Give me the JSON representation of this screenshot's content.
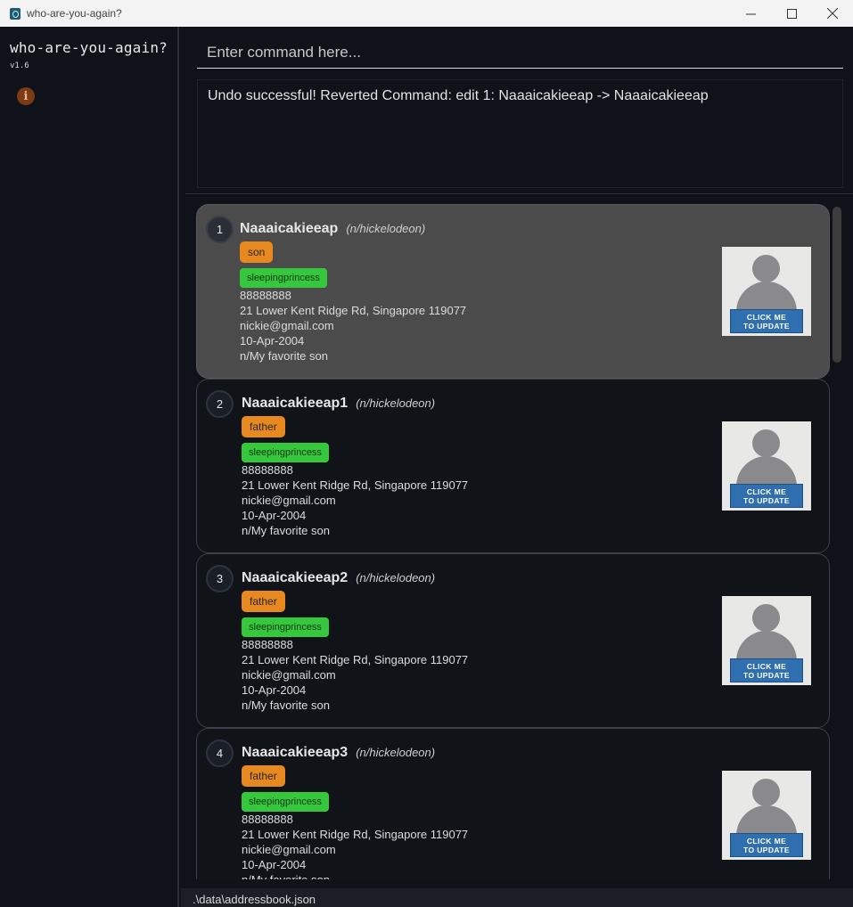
{
  "window": {
    "title": "who-are-you-again?",
    "controls": {
      "minimize": "—",
      "maximize": "☐",
      "close": "✕"
    }
  },
  "sidebar": {
    "app_name": "who-are-you-again?",
    "version": "v1.6",
    "info_icon": "info-icon"
  },
  "command": {
    "placeholder": "Enter command here..."
  },
  "result": {
    "text": "Undo successful! Reverted Command: edit 1: Naaaicakieeap -> Naaaicakieeap"
  },
  "persons": [
    {
      "index": "1",
      "name": "Naaaicakieeap",
      "nickname": "(n/hickelodeon)",
      "relationship": "son",
      "tag": "sleepingprincess",
      "phone": "88888888",
      "address": "21 Lower Kent Ridge Rd, Singapore 119077",
      "email": "nickie@gmail.com",
      "birthday": "10-Apr-2004",
      "remark": "n/My favorite son",
      "photo_label_1": "CLICK ME",
      "photo_label_2": "TO UPDATE"
    },
    {
      "index": "2",
      "name": "Naaaicakieeap1",
      "nickname": "(n/hickelodeon)",
      "relationship": "father",
      "tag": "sleepingprincess",
      "phone": "88888888",
      "address": "21 Lower Kent Ridge Rd, Singapore 119077",
      "email": "nickie@gmail.com",
      "birthday": "10-Apr-2004",
      "remark": "n/My favorite son",
      "photo_label_1": "CLICK ME",
      "photo_label_2": "TO UPDATE"
    },
    {
      "index": "3",
      "name": "Naaaicakieeap2",
      "nickname": "(n/hickelodeon)",
      "relationship": "father",
      "tag": "sleepingprincess",
      "phone": "88888888",
      "address": "21 Lower Kent Ridge Rd, Singapore 119077",
      "email": "nickie@gmail.com",
      "birthday": "10-Apr-2004",
      "remark": "n/My favorite son",
      "photo_label_1": "CLICK ME",
      "photo_label_2": "TO UPDATE"
    },
    {
      "index": "4",
      "name": "Naaaicakieeap3",
      "nickname": "(n/hickelodeon)",
      "relationship": "father",
      "tag": "sleepingprincess",
      "phone": "88888888",
      "address": "21 Lower Kent Ridge Rd, Singapore 119077",
      "email": "nickie@gmail.com",
      "birthday": "10-Apr-2004",
      "remark": "n/My favorite son",
      "photo_label_1": "CLICK ME",
      "photo_label_2": "TO UPDATE"
    }
  ],
  "status": {
    "path": ".\\data\\addressbook.json"
  },
  "colors": {
    "background": "#0f1218",
    "selected_card": "#4b4b4b",
    "relationship_tag": "#e8891f",
    "tag_green": "#35c83c",
    "update_button": "#2f6fb0"
  }
}
